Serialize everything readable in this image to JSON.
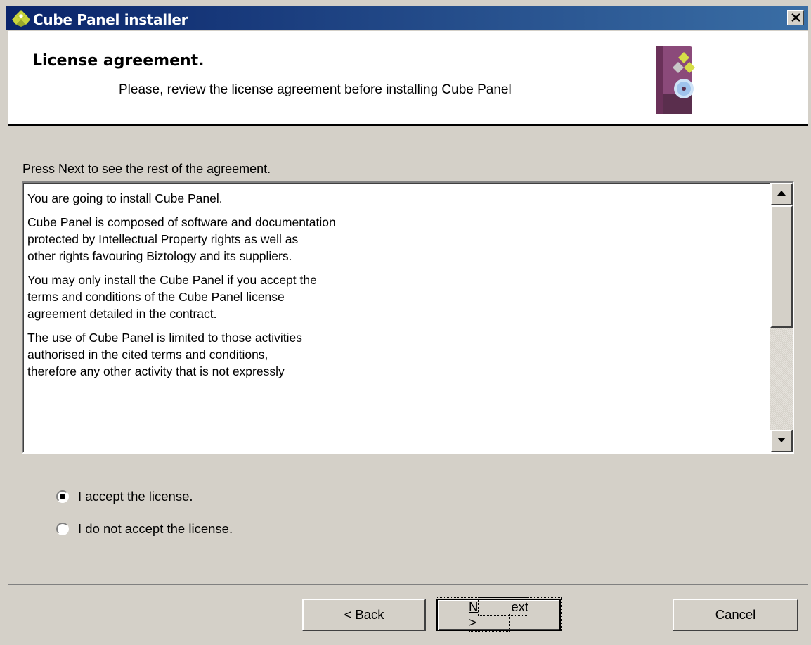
{
  "window": {
    "title": "Cube Panel installer",
    "close_label": "×"
  },
  "header": {
    "title": "License agreement.",
    "subtitle": "Please, review the license agreement before installing Cube Panel"
  },
  "instruction": "Press Next to see the rest of the agreement.",
  "license": {
    "paragraphs": [
      "You are going to install Cube Panel.",
      "Cube Panel is composed of software and documentation\nprotected by Intellectual Property rights as well as\nother rights favouring Biztology and its suppliers.",
      "You may only install the Cube Panel if you accept the\nterms and conditions of the Cube Panel license\nagreement detailed in the contract.",
      "The use of Cube Panel is limited to those activities\nauthorised in the cited terms and conditions,\ntherefore any other activity that is not expressly"
    ]
  },
  "options": {
    "accept_label": "I accept the license.",
    "decline_label": "I do not accept the license.",
    "selected": "accept"
  },
  "buttons": {
    "back_prefix": "< ",
    "back_mnemonic": "B",
    "back_rest": "ack",
    "next_mnemonic": "N",
    "next_rest": "ext >",
    "cancel_mnemonic": "C",
    "cancel_rest": "ancel"
  }
}
